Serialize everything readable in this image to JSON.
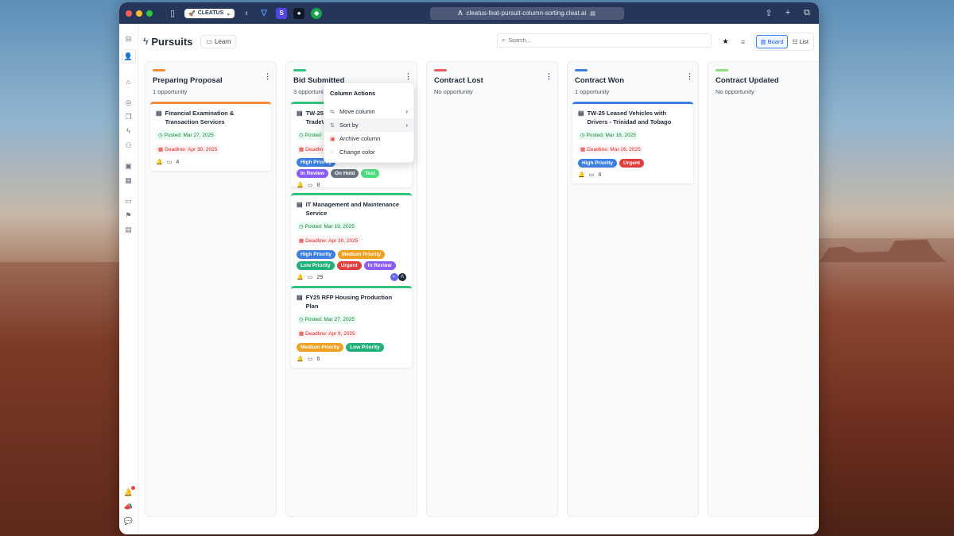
{
  "browser": {
    "tab_chip": "CLEATUS",
    "url": "cleatus-feat-pursuit-column-sorting.cleat.ai"
  },
  "header": {
    "title": "Pursuits",
    "learn_label": "Learn",
    "search_placeholder": "Search...",
    "view_board": "Board",
    "view_list": "List"
  },
  "columns": [
    {
      "title": "Preparing Proposal",
      "count": "1 opportunity",
      "color": "#f28c38"
    },
    {
      "title": "Bid Submitted",
      "count": "3 opportunity",
      "color": "#34c37d"
    },
    {
      "title": "Contract Lost",
      "count": "No opportunity",
      "color": "#ef5b5b"
    },
    {
      "title": "Contract Won",
      "count": "1 opportunity",
      "color": "#3b7fe0"
    },
    {
      "title": "Contract Updated",
      "count": "No opportunity",
      "color": "#8ee07a"
    }
  ],
  "cards": {
    "c1": {
      "title": "Financial Examination & Transaction Services",
      "posted": "Posted: Mar 27, 2025",
      "deadline": "Deadline: Apr 30, 2025",
      "comments": "4"
    },
    "c2": {
      "title_line1": "TW-25",
      "title_line2": "TradeW",
      "posted": "Posted",
      "deadline": "Deadlin",
      "tags": [
        "High Priority",
        "In Review",
        "On Hold",
        "Test"
      ],
      "comments": "8"
    },
    "c3": {
      "title": "IT Management and Maintenance Service",
      "posted": "Posted: Mar 19, 2025",
      "deadline": "Deadline: Apr 30, 2025",
      "tags": [
        "High Priority",
        "Medium Priority",
        "Low Priority",
        "Urgent",
        "In Review"
      ],
      "comments": "29"
    },
    "c4": {
      "title": "FY25 RFP Housing Production Plan",
      "posted": "Posted: Mar 27, 2025",
      "deadline": "Deadline: Apr 9, 2025",
      "tags": [
        "Medium Priority",
        "Low Priority"
      ],
      "comments": "6"
    },
    "c5": {
      "title": "TW-25 Leased Vehicles with Drivers - Trinidad and Tobago",
      "posted": "Posted: Mar 16, 2025",
      "deadline": "Deadline: Mar 26, 2025",
      "tags": [
        "High Priority",
        "Urgent"
      ],
      "comments": "4"
    }
  },
  "tag_colors": {
    "high": "#3b7fe0",
    "medium": "#f0a020",
    "low": "#22b07a",
    "urgent": "#e23d3d",
    "review": "#8b5cf6",
    "hold": "#6b7280",
    "test": "#4ade80"
  },
  "column_menu": {
    "heading": "Column Actions",
    "items": [
      "Move column",
      "Sort by",
      "Archive column",
      "Change color"
    ]
  }
}
